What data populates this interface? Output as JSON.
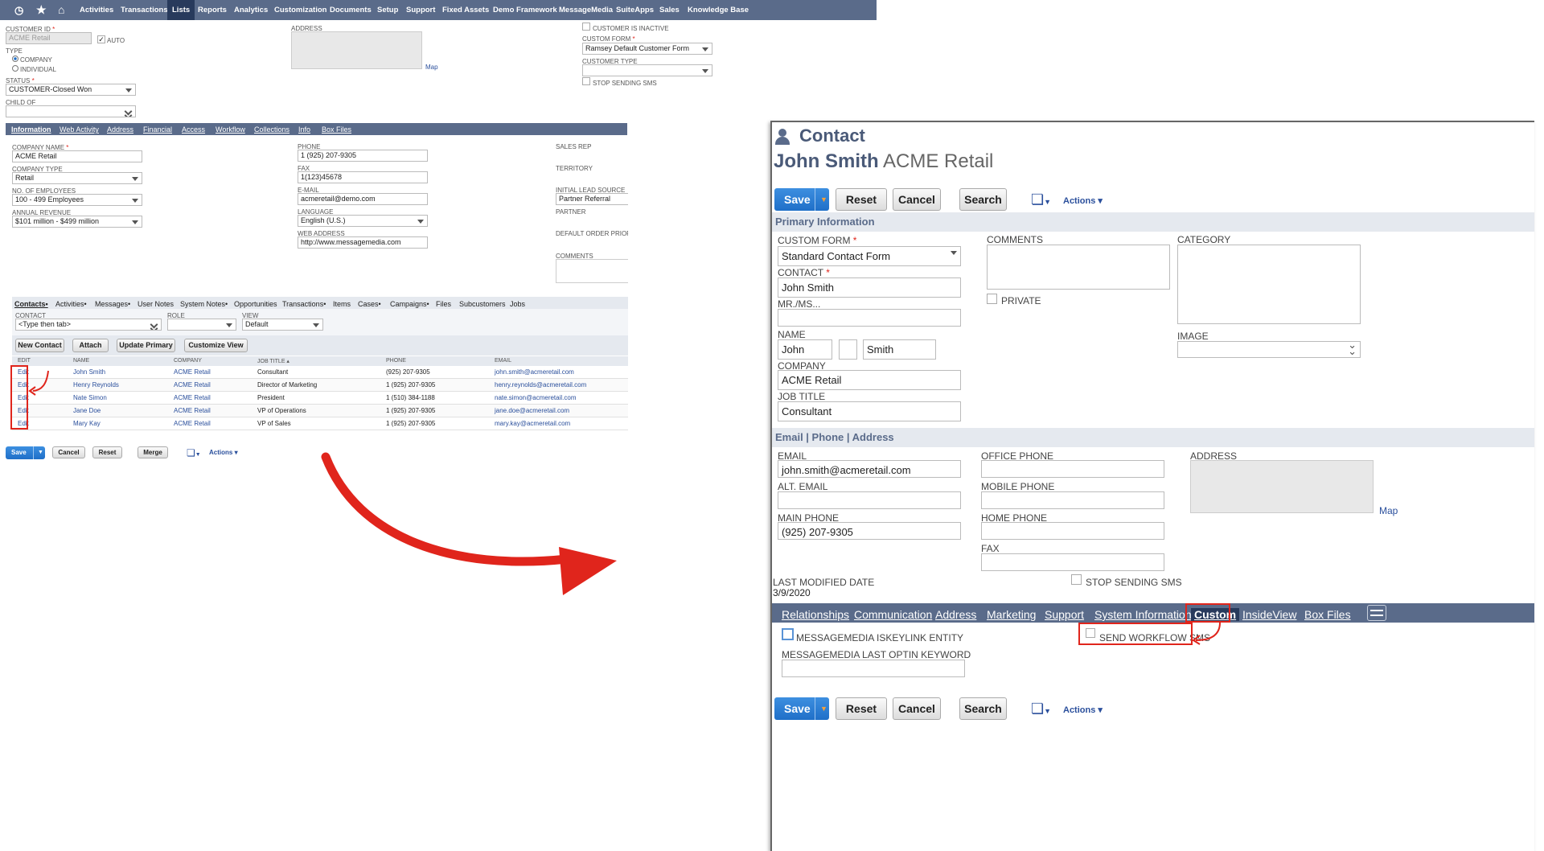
{
  "nav": {
    "items": [
      "Activities",
      "Transactions",
      "Lists",
      "Reports",
      "Analytics",
      "Customization",
      "Documents",
      "Setup",
      "Support",
      "Fixed Assets",
      "Demo Framework",
      "MessageMedia",
      "SuiteApps",
      "Sales",
      "Knowledge Base"
    ],
    "selected": "Lists"
  },
  "customer": {
    "id_label": "CUSTOMER ID",
    "id_value": "ACME Retail",
    "auto_label": "AUTO",
    "type_label": "TYPE",
    "type_company": "COMPANY",
    "type_individual": "INDIVIDUAL",
    "status_label": "STATUS",
    "status_value": "CUSTOMER-Closed Won",
    "child_label": "CHILD OF",
    "address_label": "ADDRESS",
    "map_link": "Map",
    "inactive_label": "CUSTOMER IS INACTIVE",
    "form_label": "CUSTOM FORM",
    "form_value": "Ramsey Default Customer Form",
    "ctype_label": "CUSTOMER TYPE",
    "stop_sms_label": "STOP SENDING SMS",
    "tabs": [
      "Information",
      "Web Activity",
      "Address",
      "Financial",
      "Access",
      "Workflow",
      "Collections",
      "Info",
      "Box Files"
    ],
    "company_name_label": "COMPANY NAME",
    "company_name": "ACME Retail",
    "company_type_label": "COMPANY TYPE",
    "company_type": "Retail",
    "employees_label": "NO. OF EMPLOYEES",
    "employees": "100 - 499 Employees",
    "revenue_label": "ANNUAL REVENUE",
    "revenue": "$101 million - $499 million",
    "phone_label": "PHONE",
    "phone": "1 (925) 207-9305",
    "fax_label": "FAX",
    "fax": "1(123)45678",
    "email_label": "E-MAIL",
    "email": "acmeretail@demo.com",
    "language_label": "LANGUAGE",
    "language": "English (U.S.)",
    "web_label": "WEB ADDRESS",
    "web": "http://www.messagemedia.com",
    "salesrep_label": "SALES REP",
    "territory_label": "TERRITORY",
    "lead_label": "INITIAL LEAD SOURCE",
    "lead": "Partner Referral",
    "partner_label": "PARTNER",
    "default_order_label": "DEFAULT ORDER PRIORITY",
    "comments_label": "COMMENTS",
    "subtabs": [
      "Contacts",
      "Activities",
      "Messages",
      "User Notes",
      "System Notes",
      "Opportunities",
      "Transactions",
      "Items",
      "Cases",
      "Campaigns",
      "Files",
      "Subcustomers",
      "Jobs"
    ],
    "contact_label": "CONTACT",
    "contact_placeholder": "<Type then tab>",
    "role_label": "ROLE",
    "view_label": "VIEW",
    "view_value": "Default",
    "btn_new_contact": "New Contact",
    "btn_attach": "Attach",
    "btn_update_primary": "Update Primary",
    "btn_customize": "Customize View",
    "cols": [
      "EDIT",
      "NAME",
      "COMPANY",
      "JOB TITLE ▴",
      "PHONE",
      "EMAIL"
    ],
    "rows": [
      {
        "edit": "Edit",
        "name": "John Smith",
        "company": "ACME Retail",
        "title": "Consultant",
        "phone": "(925) 207-9305",
        "email": "john.smith@acmeretail.com"
      },
      {
        "edit": "Edit",
        "name": "Henry Reynolds",
        "company": "ACME Retail",
        "title": "Director of Marketing",
        "phone": "1 (925) 207-9305",
        "email": "henry.reynolds@acmeretail.com"
      },
      {
        "edit": "Edit",
        "name": "Nate Simon",
        "company": "ACME Retail",
        "title": "President",
        "phone": "1 (510) 384-1188",
        "email": "nate.simon@acmeretail.com"
      },
      {
        "edit": "Edit",
        "name": "Jane Doe",
        "company": "ACME Retail",
        "title": "VP of Operations",
        "phone": "1 (925) 207-9305",
        "email": "jane.doe@acmeretail.com"
      },
      {
        "edit": "Edit",
        "name": "Mary Kay",
        "company": "ACME Retail",
        "title": "VP of Sales",
        "phone": "1 (925) 207-9305",
        "email": "mary.kay@acmeretail.com"
      }
    ],
    "btn_save": "Save",
    "btn_cancel": "Cancel",
    "btn_reset": "Reset",
    "btn_merge": "Merge",
    "actions": "Actions"
  },
  "contact": {
    "title": "Contact",
    "name": "John Smith",
    "company_sub": "ACME Retail",
    "btn_save": "Save",
    "btn_reset": "Reset",
    "btn_cancel": "Cancel",
    "btn_search": "Search",
    "actions": "Actions",
    "sec_primary": "Primary Information",
    "form_label": "CUSTOM FORM",
    "form_value": "Standard Contact Form",
    "contact_label": "CONTACT",
    "contact_value": "John Smith",
    "mrms_label": "MR./MS...",
    "name_label": "NAME",
    "first": "John",
    "middle": "",
    "last": "Smith",
    "company_label": "COMPANY",
    "company_value": "ACME Retail",
    "jobtitle_label": "JOB TITLE",
    "jobtitle_value": "Consultant",
    "comments_label": "COMMENTS",
    "private_label": "PRIVATE",
    "category_label": "CATEGORY",
    "image_label": "IMAGE",
    "sec_email": "Email | Phone | Address",
    "email_label": "EMAIL",
    "email_value": "john.smith@acmeretail.com",
    "alt_email_label": "ALT. EMAIL",
    "main_phone_label": "MAIN PHONE",
    "main_phone_value": "(925) 207-9305",
    "office_phone_label": "OFFICE PHONE",
    "mobile_phone_label": "MOBILE PHONE",
    "home_phone_label": "HOME PHONE",
    "fax_label": "FAX",
    "address_label": "ADDRESS",
    "map_link": "Map",
    "lastmod_label": "LAST MODIFIED DATE",
    "lastmod_value": "3/9/2020",
    "stop_sms_label": "STOP SENDING SMS",
    "tabs": [
      "Relationships",
      "Communication",
      "Address",
      "Marketing",
      "Support",
      "System Information",
      "Custom",
      "InsideView",
      "Box Files"
    ],
    "iskeylink_label": "MESSAGEMEDIA ISKEYLINK ENTITY",
    "workflow_sms_label": "SEND WORKFLOW SMS",
    "optin_label": "MESSAGEMEDIA LAST OPTIN KEYWORD"
  },
  "colors": {
    "nav": "#5a6b8a",
    "nav_selected": "#283a5c",
    "save_blue": "#1f6fc8",
    "highlight_red": "#e0251c",
    "link": "#2a4f9c"
  }
}
